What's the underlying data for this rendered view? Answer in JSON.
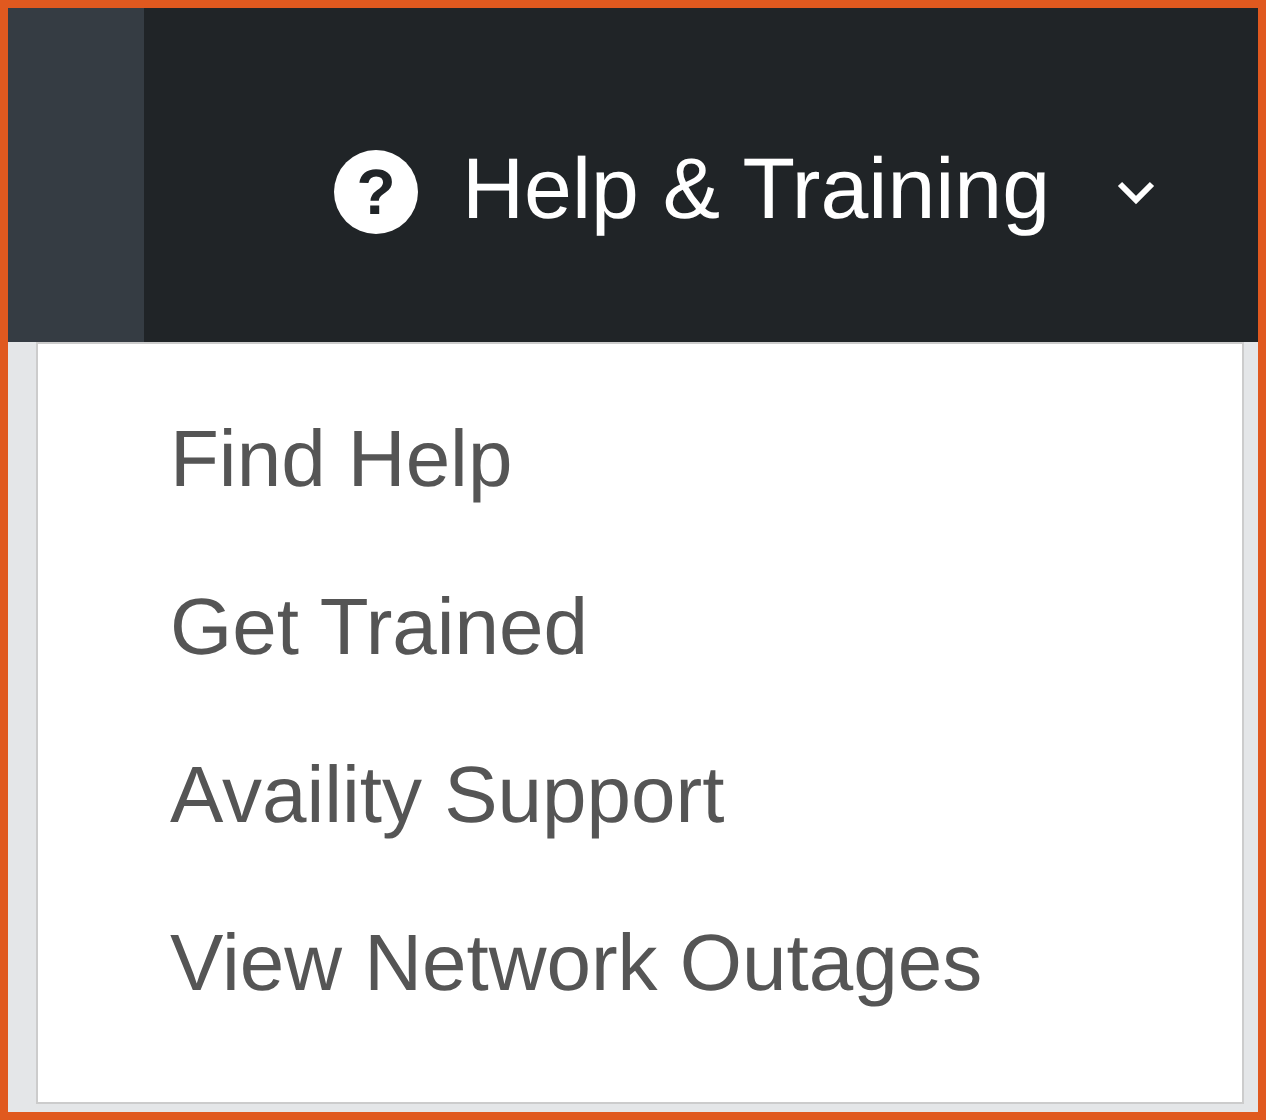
{
  "navbar": {
    "toggle": {
      "icon": "?",
      "label": "Help & Training",
      "expanded": true
    },
    "menu": [
      {
        "label": "Find Help"
      },
      {
        "label": "Get Trained"
      },
      {
        "label": "Availity Support"
      },
      {
        "label": "View Network Outages"
      }
    ]
  }
}
